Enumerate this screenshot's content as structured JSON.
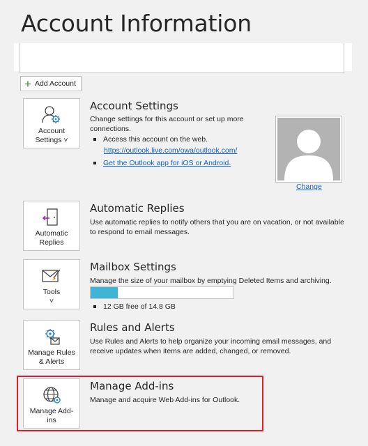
{
  "page": {
    "title": "Account Information"
  },
  "add_account": {
    "label": "Add Account",
    "icon": "plus-icon"
  },
  "account_settings": {
    "tile_label_line1": "Account",
    "tile_label_line2": "Settings ˅",
    "title": "Account Settings",
    "description": "Change settings for this account or set up more connections.",
    "bullet1": "Access this account on the web.",
    "link1": "https://outlook.live.com/owa/outlook.com/",
    "link2": "Get the Outlook app for iOS or Android.",
    "change_label": "Change"
  },
  "automatic_replies": {
    "tile_label_line1": "Automatic",
    "tile_label_line2": "Replies",
    "title": "Automatic Replies",
    "description": "Use automatic replies to notify others that you are on vacation, or not available to respond to email messages."
  },
  "mailbox_settings": {
    "tile_label_line1": "Tools",
    "tile_label_line2": "˅",
    "title": "Mailbox Settings",
    "description": "Manage the size of your mailbox by emptying Deleted Items and archiving.",
    "usage_text": "12 GB free of 14.8 GB",
    "used_fraction": 0.19
  },
  "rules_alerts": {
    "tile_label_line1": "Manage Rules",
    "tile_label_line2": "& Alerts",
    "title": "Rules and Alerts",
    "description": "Use Rules and Alerts to help organize your incoming email messages, and receive updates when items are added, changed, or removed."
  },
  "addins": {
    "tile_label_line1": "Manage Add-",
    "tile_label_line2": "ins",
    "title": "Manage Add-ins",
    "description": "Manage and acquire Web Add-ins for Outlook."
  },
  "colors": {
    "link": "#1565c0",
    "highlight": "#e51c23",
    "progress": "#3fb4d4"
  }
}
